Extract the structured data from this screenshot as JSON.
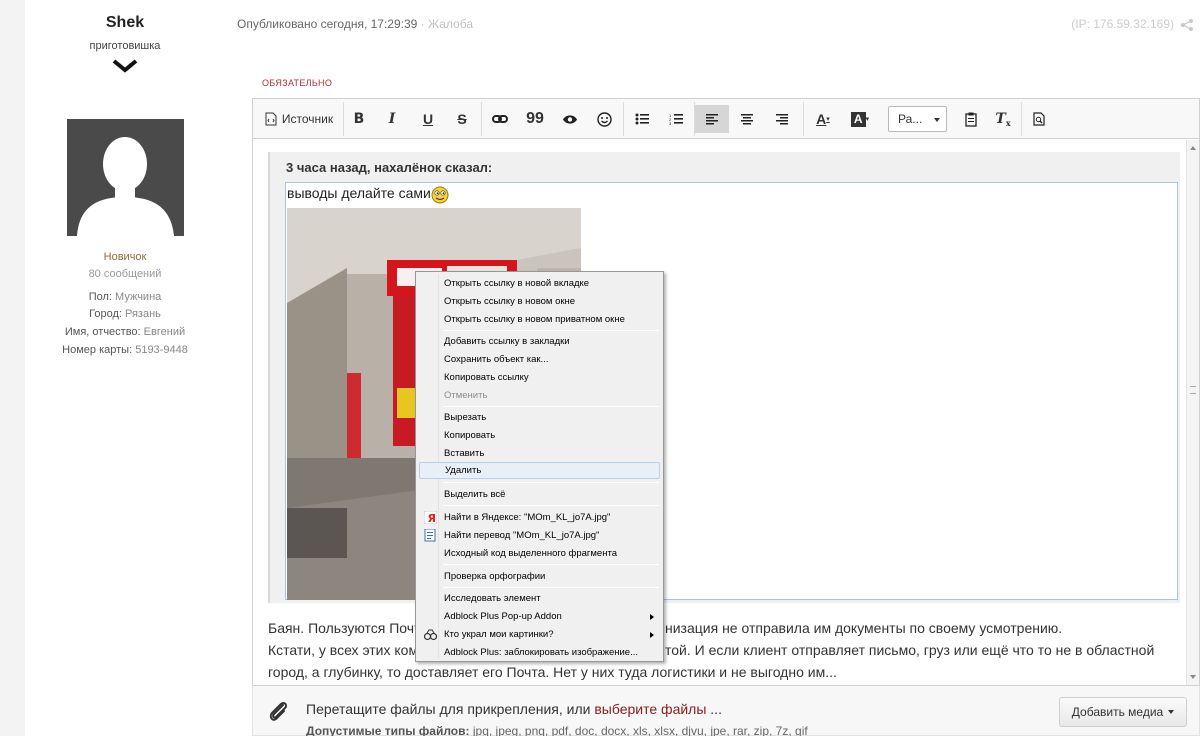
{
  "profile": {
    "name": "Shek",
    "rank": "приготовишка",
    "status": "Новичок",
    "posts": "80 сообщений",
    "fields": [
      {
        "label": "Пол:",
        "value": "Мужчина"
      },
      {
        "label": "Город:",
        "value": "Рязань"
      },
      {
        "label": "Имя, отчество:",
        "value": "Евгений"
      },
      {
        "label": "Номер карты:",
        "value": "5193-9448"
      }
    ]
  },
  "header": {
    "published": "Опубликовано",
    "time": "сегодня, 17:29:39",
    "separator": "·",
    "complaint": "Жалоба",
    "ip": "(IP: 176.59.32.169)"
  },
  "required_label": "ОБЯЗАТЕЛЬНО",
  "toolbar": {
    "source_label": "Источник",
    "bold": "B",
    "italic": "I",
    "underline": "U",
    "strike": "S",
    "quote_mark": "99",
    "font_color": "A",
    "bg_color": "A",
    "format_select": "Ра...",
    "clear_format": "T"
  },
  "quote": {
    "author_line": "3 часа назад, нахалёнок сказал:",
    "text": "выводы делайте сами"
  },
  "post_lines": [
    "Баян. Пользуются Почт",
    "низация не отправила им документы по своему усмотрению.",
    "Кстати, у всех этих комп",
    "той. И если клиент отправляет письмо, груз или ещё что то не в областной",
    "город, а глубинку, то доставляет его Почта. Нет у них туда логистики и не выгодно им..."
  ],
  "context_menu": {
    "items": [
      {
        "label": "Открыть ссылку в новой вкладке"
      },
      {
        "label": "Открыть ссылку в новом окне"
      },
      {
        "label": "Открыть ссылку в новом приватном окне"
      },
      {
        "label": "Добавить ссылку в закладки"
      },
      {
        "label": "Сохранить объект как..."
      },
      {
        "label": "Копировать ссылку"
      },
      {
        "label": "Отменить"
      },
      {
        "label": "Вырезать"
      },
      {
        "label": "Копировать"
      },
      {
        "label": "Вставить"
      },
      {
        "label": "Удалить"
      },
      {
        "label": "Выделить всё"
      },
      {
        "label": "Найти в Яндексе: \"MOm_KL_jo7A.jpg\""
      },
      {
        "label": "Найти перевод \"MOm_KL_jo7A.jpg\""
      },
      {
        "label": "Исходный код выделенного фрагмента"
      },
      {
        "label": "Проверка орфографии"
      },
      {
        "label": "Исследовать элемент"
      },
      {
        "label": "Adblock Plus Pop-up Addon"
      },
      {
        "label": "Кто украл мои картинки?"
      },
      {
        "label": "Adblock Plus: заблокировать изображение..."
      }
    ]
  },
  "attach": {
    "prompt": "Перетащите файлы для прикрепления, или",
    "link": "выберите файлы",
    "ellipsis": "...",
    "types_label": "Допустимые типы файлов:",
    "types": "jpg, jpeg, png, pdf, doc, docx, xls, xlsx, djvu, jpe, rar, zip, 7z, gif",
    "media_button": "Добавить медиа"
  },
  "colors": {
    "accent_link": "#8b1a1a",
    "required": "#b03030",
    "status": "#8a6d3b"
  }
}
